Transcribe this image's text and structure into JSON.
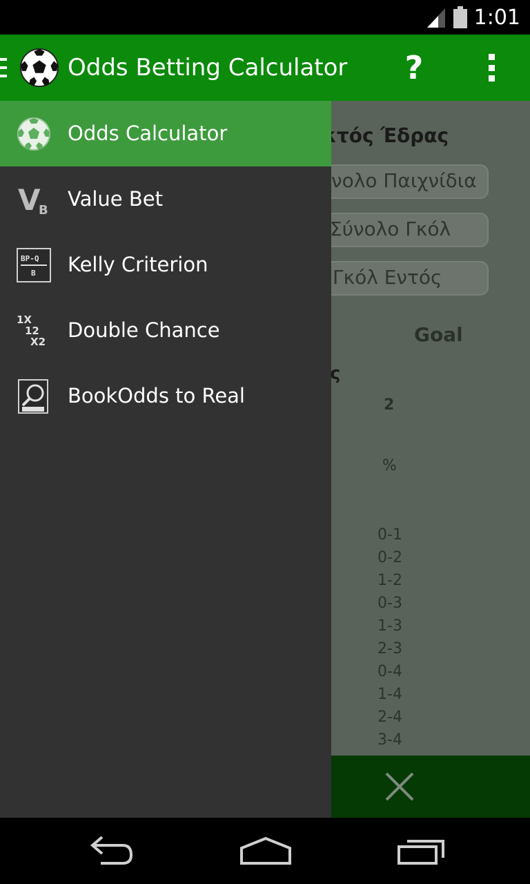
{
  "status_bar": {
    "time": "1:01"
  },
  "action_bar": {
    "title": "Odds Betting Calculator",
    "help_label": "?"
  },
  "drawer": {
    "items": [
      {
        "label": "Odds Calculator",
        "icon": "soccer-ball-icon",
        "active": true
      },
      {
        "label": "Value Bet",
        "icon": "value-bet-icon"
      },
      {
        "label": "Kelly Criterion",
        "icon": "kelly-formula-icon"
      },
      {
        "label": "Double Chance",
        "icon": "double-chance-icon"
      },
      {
        "label": "BookOdds to Real",
        "icon": "magnifier-odds-icon"
      }
    ]
  },
  "content": {
    "header": "κτός Έδρας",
    "fields": [
      "νολο Παιχνίδια",
      "Σύνολο Γκόλ",
      "Γκόλ Εντός"
    ],
    "goal_label": "Goal",
    "partial_label": "ς",
    "col_header": "2",
    "percent_label": "%",
    "scores": [
      "0-1",
      "0-2",
      "1-2",
      "0-3",
      "1-3",
      "2-3",
      "0-4",
      "1-4",
      "2-4",
      "3-4"
    ]
  },
  "colors": {
    "action_bar": "#0b8a0b",
    "drawer_bg": "#323232",
    "drawer_active": "#3d9b3d",
    "bottom_bar": "#053a05"
  }
}
